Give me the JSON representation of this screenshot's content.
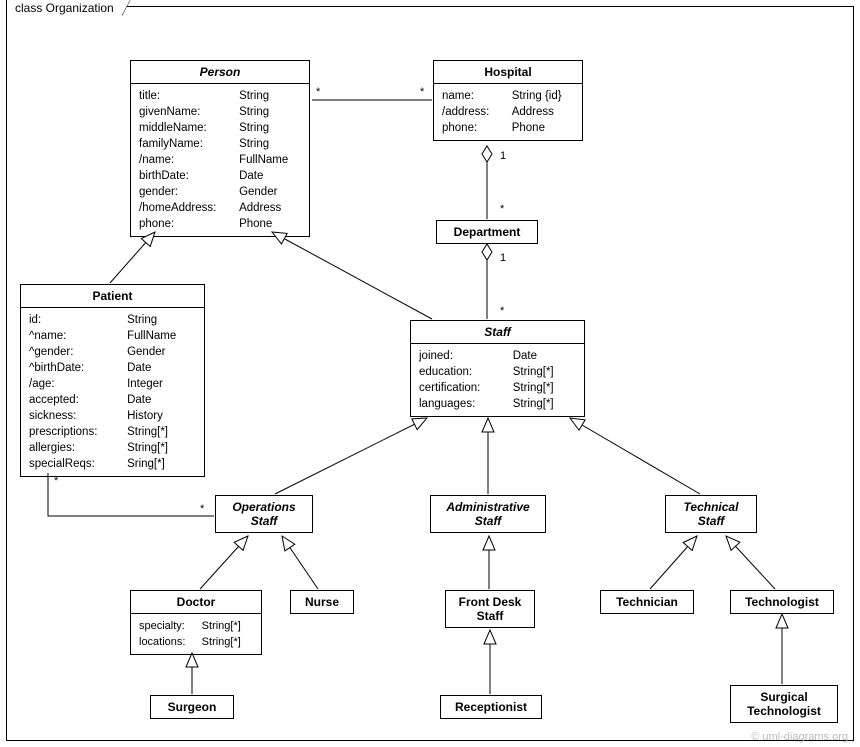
{
  "frame": {
    "title": "class Organization"
  },
  "credit": "© uml-diagrams.org",
  "classes": {
    "person": {
      "name": "Person",
      "attrs": [
        [
          "title:",
          "String"
        ],
        [
          "givenName:",
          "String"
        ],
        [
          "middleName:",
          "String"
        ],
        [
          "familyName:",
          "String"
        ],
        [
          "/name:",
          "FullName"
        ],
        [
          "birthDate:",
          "Date"
        ],
        [
          "gender:",
          "Gender"
        ],
        [
          "/homeAddress:",
          "Address"
        ],
        [
          "phone:",
          "Phone"
        ]
      ]
    },
    "hospital": {
      "name": "Hospital",
      "attrs": [
        [
          "name:",
          "String {id}"
        ],
        [
          "/address:",
          "Address"
        ],
        [
          "phone:",
          "Phone"
        ]
      ]
    },
    "department": {
      "name": "Department",
      "attrs": []
    },
    "patient": {
      "name": "Patient",
      "attrs": [
        [
          "id:",
          "String"
        ],
        [
          "^name:",
          "FullName"
        ],
        [
          "^gender:",
          "Gender"
        ],
        [
          "^birthDate:",
          "Date"
        ],
        [
          "/age:",
          "Integer"
        ],
        [
          "accepted:",
          "Date"
        ],
        [
          "sickness:",
          "History"
        ],
        [
          "prescriptions:",
          "String[*]"
        ],
        [
          "allergies:",
          "String[*]"
        ],
        [
          "specialReqs:",
          "Sring[*]"
        ]
      ]
    },
    "staff": {
      "name": "Staff",
      "attrs": [
        [
          "joined:",
          "Date"
        ],
        [
          "education:",
          "String[*]"
        ],
        [
          "certification:",
          "String[*]"
        ],
        [
          "languages:",
          "String[*]"
        ]
      ]
    },
    "opsStaff": {
      "name": "Operations\nStaff",
      "attrs": []
    },
    "adminStaff": {
      "name": "Administrative\nStaff",
      "attrs": []
    },
    "techStaff": {
      "name": "Technical\nStaff",
      "attrs": []
    },
    "doctor": {
      "name": "Doctor",
      "attrs": [
        [
          "specialty:",
          "String[*]"
        ],
        [
          "locations:",
          "String[*]"
        ]
      ]
    },
    "nurse": {
      "name": "Nurse",
      "attrs": []
    },
    "frontDesk": {
      "name": "Front Desk\nStaff",
      "attrs": []
    },
    "technician": {
      "name": "Technician",
      "attrs": []
    },
    "technologist": {
      "name": "Technologist",
      "attrs": []
    },
    "surgeon": {
      "name": "Surgeon",
      "attrs": []
    },
    "receptionist": {
      "name": "Receptionist",
      "attrs": []
    },
    "surgTech": {
      "name": "Surgical\nTechnologist",
      "attrs": []
    }
  },
  "multiplicities": {
    "pers_hosp_p": "*",
    "pers_hosp_h": "*",
    "hosp_dept_h": "1",
    "hosp_dept_d": "*",
    "dept_staff_d": "1",
    "dept_staff_s": "*",
    "pat_ops_p": "*",
    "pat_ops_o": "*"
  }
}
